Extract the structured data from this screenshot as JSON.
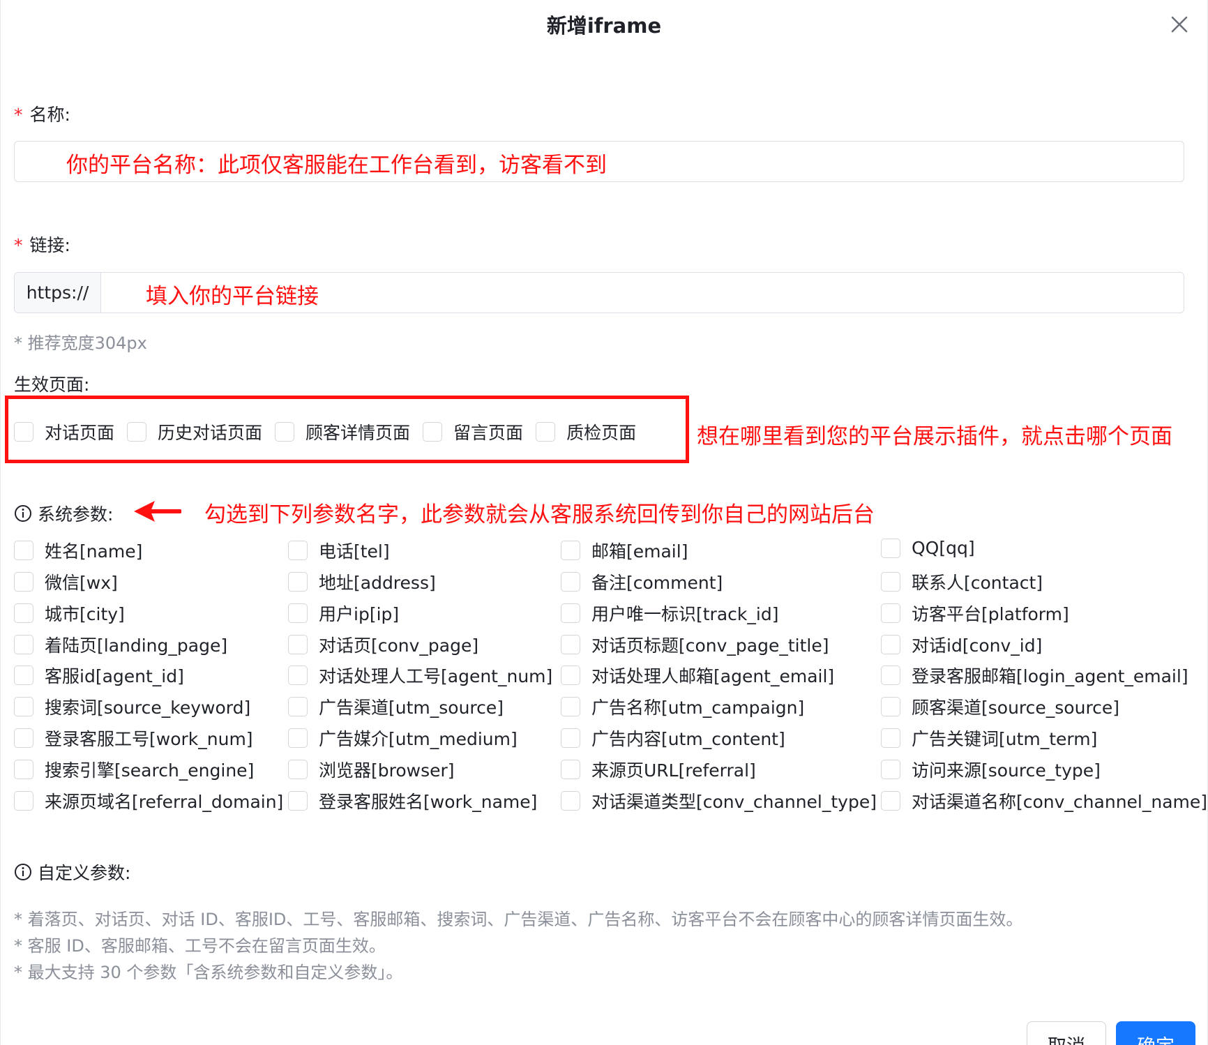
{
  "dialog": {
    "title": "新增iframe"
  },
  "name_field": {
    "label": "名称:",
    "required_mark": "*",
    "annotation": "你的平台名称：此项仅客服能在工作台看到，访客看不到"
  },
  "link_field": {
    "label": "链接:",
    "required_mark": "*",
    "prefix": "https://",
    "annotation": "填入你的平台链接",
    "hint": "* 推荐宽度304px"
  },
  "effective_pages": {
    "label": "生效页面:",
    "options": [
      "对话页面",
      "历史对话页面",
      "顾客详情页面",
      "留言页面",
      "质检页面"
    ],
    "annotation": "想在哪里看到您的平台展示插件，就点击哪个页面"
  },
  "system_params": {
    "label": "系统参数:",
    "annotation": "勾选到下列参数名字，此参数就会从客服系统回传到你自己的网站后台",
    "rows": [
      [
        "姓名[name]",
        "电话[tel]",
        "邮箱[email]",
        "QQ[qq]"
      ],
      [
        "微信[wx]",
        "地址[address]",
        "备注[comment]",
        "联系人[contact]"
      ],
      [
        "城市[city]",
        "用户ip[ip]",
        "用户唯一标识[track_id]",
        "访客平台[platform]"
      ],
      [
        "着陆页[landing_page]",
        "对话页[conv_page]",
        "对话页标题[conv_page_title]",
        "对话id[conv_id]"
      ],
      [
        "客服id[agent_id]",
        "对话处理人工号[agent_num]",
        "对话处理人邮箱[agent_email]",
        "登录客服邮箱[login_agent_email]"
      ],
      [
        "搜索词[source_keyword]",
        "广告渠道[utm_source]",
        "广告名称[utm_campaign]",
        "顾客渠道[source_source]"
      ],
      [
        "登录客服工号[work_num]",
        "广告媒介[utm_medium]",
        "广告内容[utm_content]",
        "广告关键词[utm_term]"
      ],
      [
        "搜索引擎[search_engine]",
        "浏览器[browser]",
        "来源页URL[referral]",
        "访问来源[source_type]"
      ],
      [
        "来源页域名[referral_domain]",
        "登录客服姓名[work_name]",
        "对话渠道类型[conv_channel_type]",
        "对话渠道名称[conv_channel_name]"
      ]
    ]
  },
  "custom_params": {
    "label": "自定义参数:",
    "notes": [
      "* 着落页、对话页、对话 ID、客服ID、工号、客服邮箱、搜索词、广告渠道、广告名称、访客平台不会在顾客中心的顾客详情页面生效。",
      "* 客服 ID、客服邮箱、工号不会在留言页面生效。",
      "* 最大支持 30 个参数「含系统参数和自定义参数」。"
    ]
  },
  "footer": {
    "cancel_label": "取消",
    "confirm_label": "确定",
    "primary_color": "#1677ff"
  },
  "colors": {
    "annotation": "#ff1111",
    "required": "#f5222d"
  }
}
